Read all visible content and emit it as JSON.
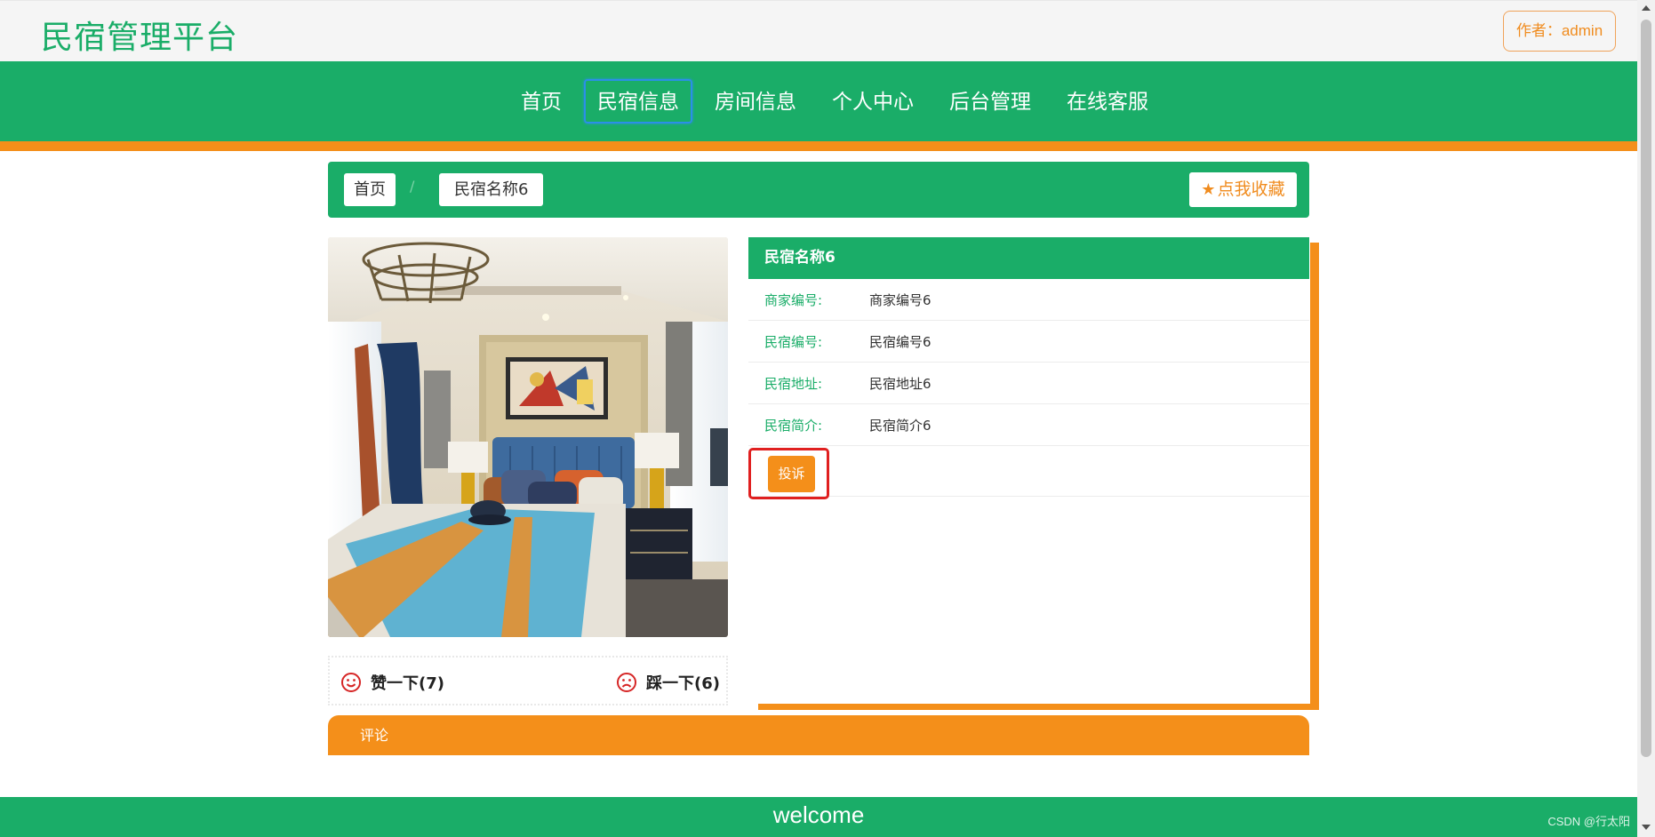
{
  "header": {
    "title": "民宿管理平台",
    "author": "作者：admin"
  },
  "nav": {
    "items": [
      {
        "label": "首页",
        "active": false
      },
      {
        "label": "民宿信息",
        "active": true
      },
      {
        "label": "房间信息",
        "active": false
      },
      {
        "label": "个人中心",
        "active": false
      },
      {
        "label": "后台管理",
        "active": false
      },
      {
        "label": "在线客服",
        "active": false
      }
    ]
  },
  "breadcrumb": {
    "home": "首页",
    "separator": "/",
    "current": "民宿名称6",
    "favorite_label": "点我收藏",
    "favorite_icon": "star-icon"
  },
  "votes": {
    "like_label": "赞一下(7)",
    "like_icon": "smile-icon",
    "dislike_label": "踩一下(6)",
    "dislike_icon": "frown-icon"
  },
  "detail": {
    "title": "民宿名称6",
    "rows": [
      {
        "label": "商家编号:",
        "value": "商家编号6"
      },
      {
        "label": "民宿编号:",
        "value": "民宿编号6"
      },
      {
        "label": "民宿地址:",
        "value": "民宿地址6"
      },
      {
        "label": "民宿简介:",
        "value": "民宿简介6"
      }
    ],
    "complain_label": "投诉"
  },
  "comments": {
    "title": "评论"
  },
  "footer": {
    "text": "welcome",
    "watermark": "CSDN @行太阳"
  },
  "colors": {
    "primary_green": "#1aad68",
    "accent_orange": "#f48f1a",
    "highlight_red": "#e02020",
    "active_blue": "#2b8fe8"
  }
}
